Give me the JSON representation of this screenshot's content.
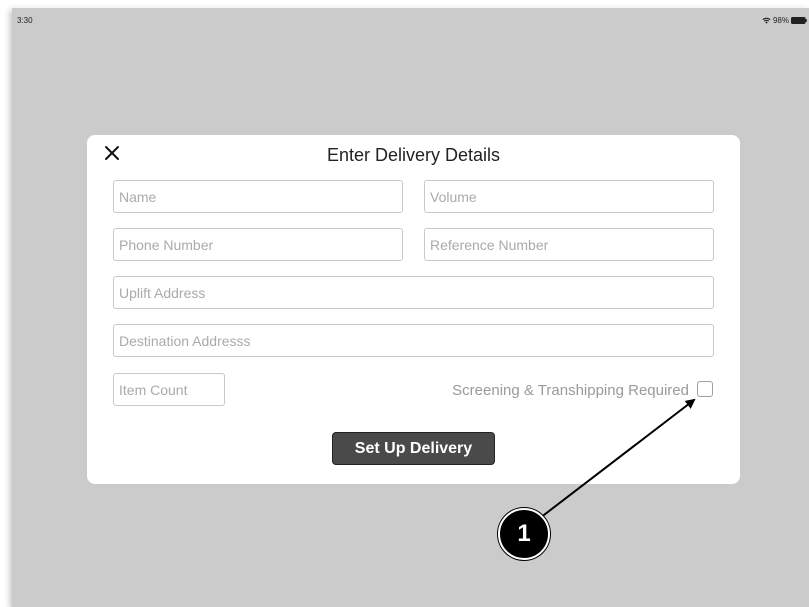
{
  "status_bar": {
    "time": "3:30",
    "battery": "98%",
    "wifi_icon": "wifi-icon",
    "battery_icon": "battery-icon"
  },
  "modal": {
    "title": "Enter Delivery Details",
    "close_icon": "close-icon",
    "fields": {
      "name": {
        "value": "",
        "placeholder": "Name"
      },
      "volume": {
        "value": "",
        "placeholder": "Volume"
      },
      "phone": {
        "value": "",
        "placeholder": "Phone Number"
      },
      "reference": {
        "value": "",
        "placeholder": "Reference Number"
      },
      "uplift_address": {
        "value": "",
        "placeholder": "Uplift Address"
      },
      "destination_address": {
        "value": "",
        "placeholder": "Destination Addresss"
      },
      "item_count": {
        "value": "",
        "placeholder": "Item Count"
      }
    },
    "screening_label": "Screening & Transhipping Required",
    "screening_checked": false,
    "submit_label": "Set Up Delivery"
  },
  "annotation": {
    "callout_number": "1"
  },
  "colors": {
    "backdrop": "#cbcbcb",
    "button_bg": "#4a4a4a",
    "field_border": "#c9c9c9",
    "placeholder": "#aaaaaa"
  }
}
